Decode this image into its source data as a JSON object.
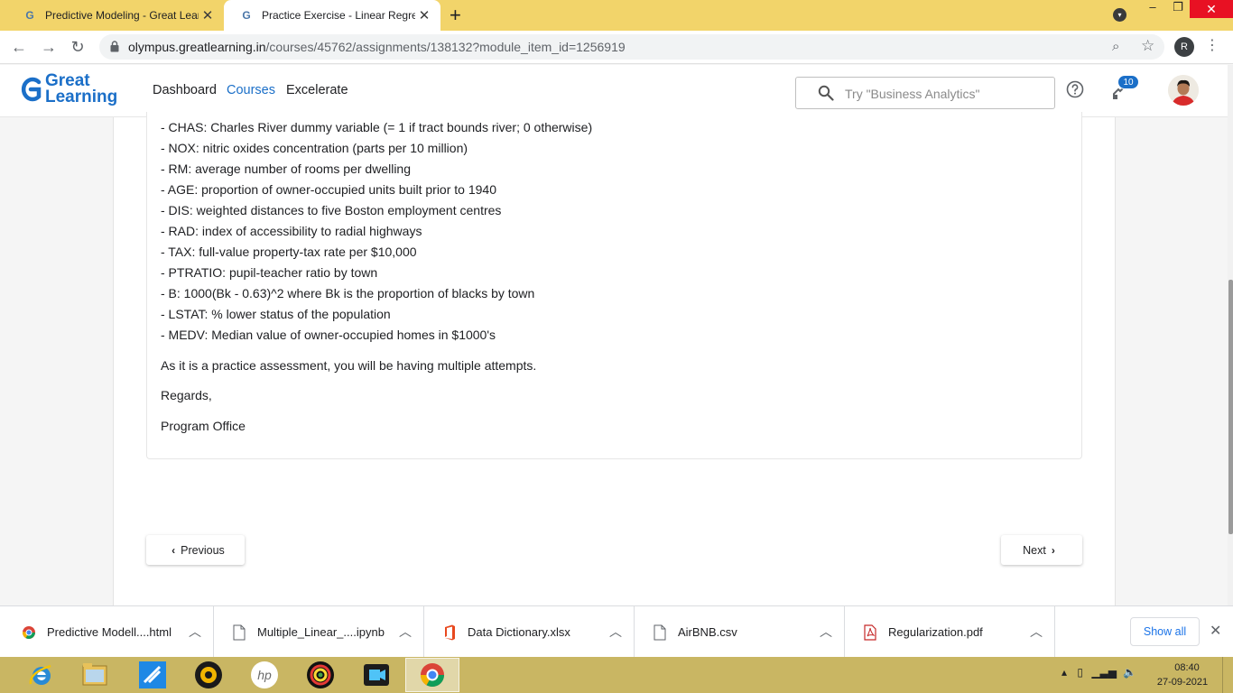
{
  "browser": {
    "tabs": [
      {
        "title": "Predictive Modeling - Great Lear",
        "favicon": "google-g-icon"
      },
      {
        "title": "Practice Exercise - Linear Regress",
        "favicon": "google-g-icon"
      }
    ],
    "new_tab": "+",
    "url_host": "olympus.greatlearning.in",
    "url_path": "/courses/45762/assignments/138132?module_item_id=1256919",
    "profile_initial": "R"
  },
  "site": {
    "logo_line1": "Great",
    "logo_line2": "Learning",
    "nav": {
      "dashboard": "Dashboard",
      "courses": "Courses",
      "excelerate": "Excelerate"
    },
    "search_placeholder": "Try \"Business Analytics\"",
    "notification_count": "10"
  },
  "content": {
    "variables": [
      "- CHAS: Charles River dummy variable (= 1 if tract bounds river; 0 otherwise)",
      "- NOX: nitric oxides concentration (parts per 10 million)",
      "- RM: average number of rooms per dwelling",
      "- AGE: proportion of owner-occupied units built prior to 1940",
      "- DIS: weighted distances to five Boston employment centres",
      "- RAD: index of accessibility to radial highways",
      "- TAX: full-value property-tax rate per $10,000",
      "- PTRATIO: pupil-teacher ratio by town",
      "- B: 1000(Bk - 0.63)^2 where Bk is the proportion of blacks by town",
      "- LSTAT: % lower status of the population",
      "- MEDV: Median value of owner-occupied homes in $1000's"
    ],
    "note": "As it is a practice assessment, you will be having multiple attempts.",
    "regards": "Regards,",
    "signature": "Program Office",
    "prev_label": "Previous",
    "next_label": "Next"
  },
  "downloads": {
    "items": [
      {
        "name": "Predictive Modell....html",
        "icon": "chrome-file-icon"
      },
      {
        "name": "Multiple_Linear_....ipynb",
        "icon": "document-icon"
      },
      {
        "name": "Data Dictionary.xlsx",
        "icon": "office-icon"
      },
      {
        "name": "AirBNB.csv",
        "icon": "document-icon"
      },
      {
        "name": "Regularization.pdf",
        "icon": "pdf-icon"
      }
    ],
    "show_all": "Show all"
  },
  "taskbar": {
    "clock_time": "08:40",
    "clock_date": "27-09-2021"
  },
  "colors": {
    "brand_blue": "#1b6fc8",
    "tabstrip": "#f2d46a",
    "taskbar": "#c9b663"
  }
}
